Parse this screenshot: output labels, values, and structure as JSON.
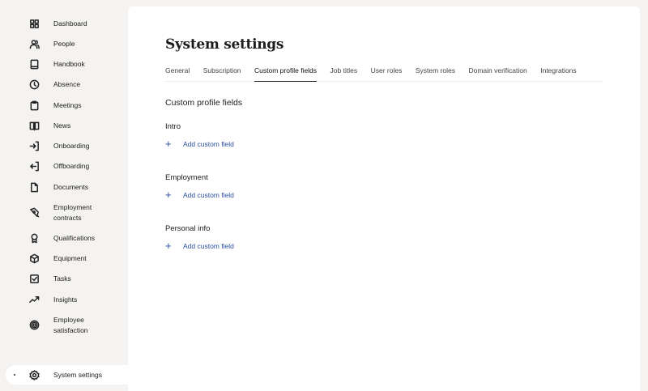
{
  "sidebar": {
    "items": [
      {
        "label": "Dashboard",
        "icon": "grid-icon"
      },
      {
        "label": "People",
        "icon": "people-icon"
      },
      {
        "label": "Handbook",
        "icon": "book-icon"
      },
      {
        "label": "Absence",
        "icon": "clock-icon"
      },
      {
        "label": "Meetings",
        "icon": "clipboard-icon"
      },
      {
        "label": "News",
        "icon": "open-book-icon"
      },
      {
        "label": "Onboarding",
        "icon": "sign-in-icon"
      },
      {
        "label": "Offboarding",
        "icon": "sign-out-icon"
      },
      {
        "label": "Documents",
        "icon": "document-icon"
      },
      {
        "label": "Employment contracts",
        "icon": "pen-icon"
      },
      {
        "label": "Qualifications",
        "icon": "award-icon"
      },
      {
        "label": "Equipment",
        "icon": "box-icon"
      },
      {
        "label": "Tasks",
        "icon": "checkbox-icon"
      },
      {
        "label": "Insights",
        "icon": "trend-icon"
      },
      {
        "label": "Employee satisfaction",
        "icon": "target-icon"
      }
    ],
    "system_settings": {
      "label": "System settings",
      "icon": "gear-icon",
      "active": true
    }
  },
  "header": {
    "title": "System settings"
  },
  "tabs": [
    {
      "label": "General"
    },
    {
      "label": "Subscription"
    },
    {
      "label": "Custom profile fields",
      "active": true
    },
    {
      "label": "Job titles"
    },
    {
      "label": "User roles"
    },
    {
      "label": "System roles"
    },
    {
      "label": "Domain verification"
    },
    {
      "label": "Integrations"
    }
  ],
  "content": {
    "title": "Custom profile fields",
    "groups": [
      {
        "title": "Intro",
        "add_label": "Add custom field"
      },
      {
        "title": "Employment",
        "add_label": "Add custom field"
      },
      {
        "title": "Personal info",
        "add_label": "Add custom field"
      }
    ]
  },
  "colors": {
    "accent": "#2a4fa0",
    "sidebar_bg": "#f4f3f1"
  }
}
